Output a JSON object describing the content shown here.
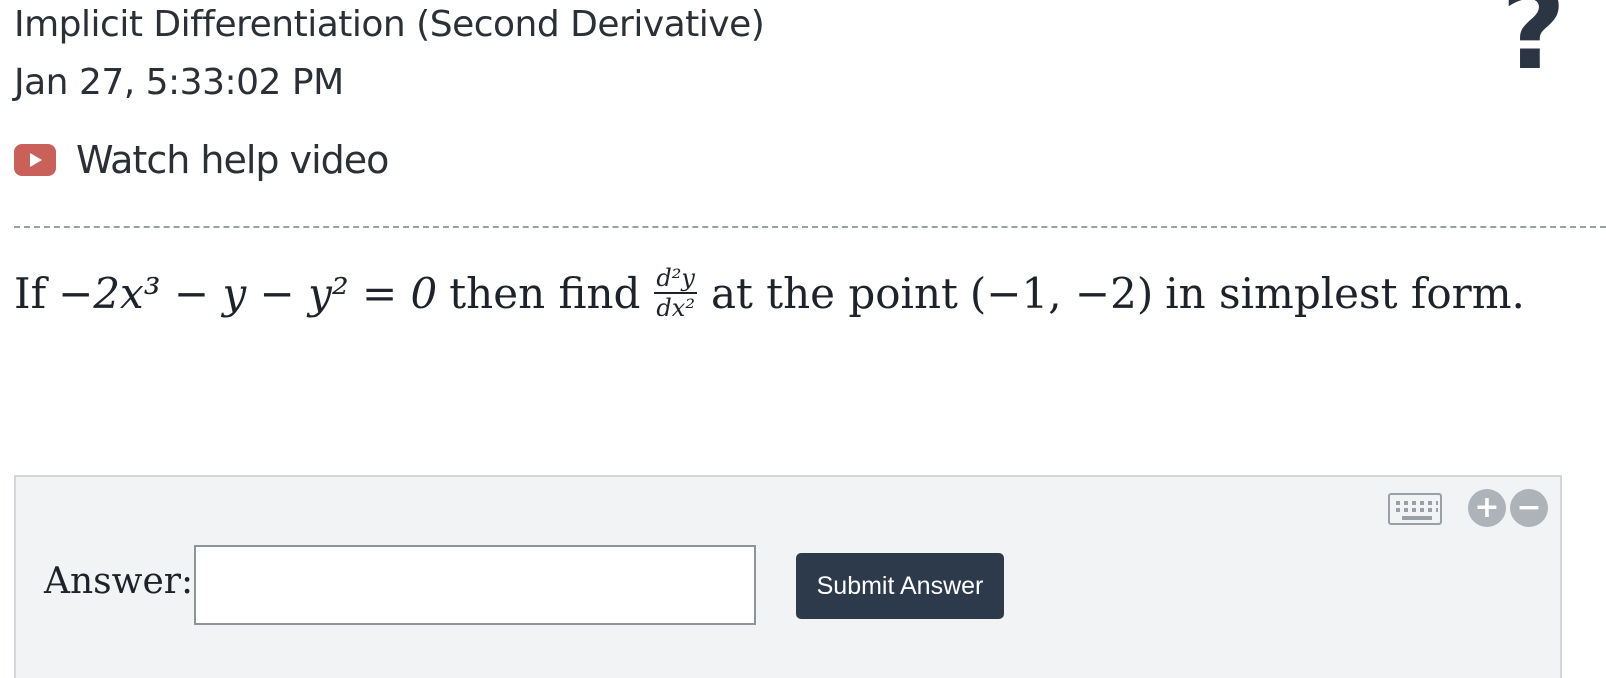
{
  "header": {
    "title": "Implicit Differentiation (Second Derivative)",
    "date": "Jan 27, 5:33:02 PM",
    "help_glyph": "?"
  },
  "help_video": {
    "label": "Watch help video",
    "icon": "play-video-icon",
    "icon_color": "#c9605a"
  },
  "question": {
    "prefix": "If",
    "equation": "−2x³ − y − y² = 0",
    "middle": "then find",
    "derivative_numerator": "d²y",
    "derivative_denominator": "dx²",
    "suffix": "at the point",
    "point": "(−1, −2)",
    "ending": "in simplest form."
  },
  "answer": {
    "label": "Answer:",
    "value": "",
    "placeholder": "",
    "submit_label": "Submit Answer",
    "submit_color": "#2d3a4b"
  },
  "tools": {
    "keyboard_icon": "keyboard-icon",
    "zoom_in_glyph": "+",
    "zoom_out_glyph": "−"
  }
}
